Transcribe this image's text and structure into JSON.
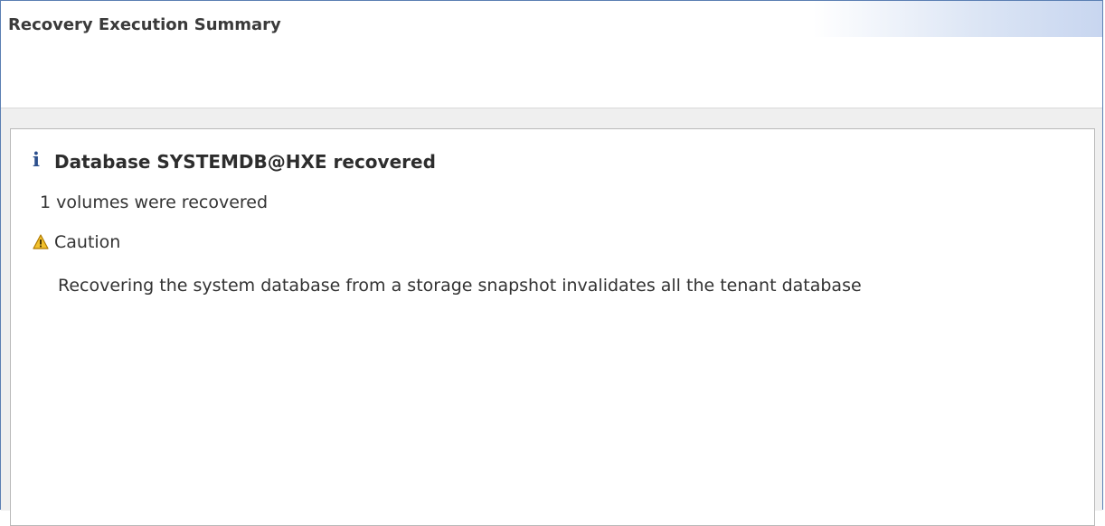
{
  "header": {
    "title": "Recovery Execution Summary"
  },
  "summary": {
    "info_icon": "info-icon",
    "title": "Database SYSTEMDB@HXE recovered",
    "volumes_text": "1 volumes were recovered",
    "caution_icon": "warning-triangle-icon",
    "caution_label": "Caution",
    "description": "Recovering the system database from a storage snapshot invalidates all the tenant database"
  },
  "colors": {
    "border": "#5b7fb3",
    "info_icon": "#2c4f8c",
    "caution_icon": "#f0b400",
    "panel_background": "#efefef"
  }
}
